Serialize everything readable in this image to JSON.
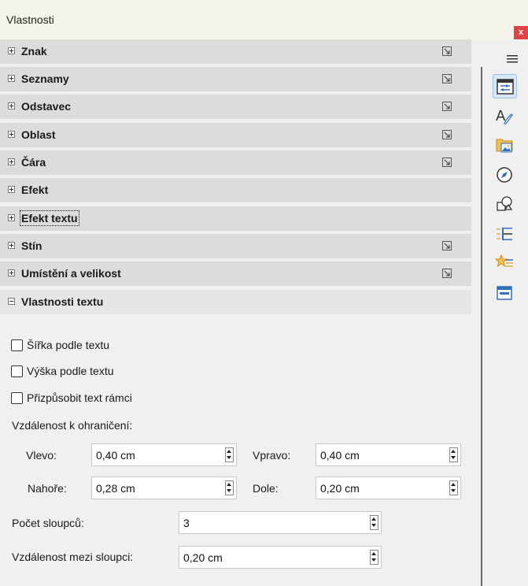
{
  "window": {
    "title": "Vlastnosti",
    "close_label": "x"
  },
  "sections": [
    {
      "label": "Znak",
      "expanded": false,
      "has_more": true
    },
    {
      "label": "Seznamy",
      "expanded": false,
      "has_more": true
    },
    {
      "label": "Odstavec",
      "expanded": false,
      "has_more": true
    },
    {
      "label": "Oblast",
      "expanded": false,
      "has_more": true
    },
    {
      "label": "Čára",
      "expanded": false,
      "has_more": true
    },
    {
      "label": "Efekt",
      "expanded": false,
      "has_more": false
    },
    {
      "label": "Efekt textu",
      "expanded": false,
      "has_more": false,
      "focused": true
    },
    {
      "label": "Stín",
      "expanded": false,
      "has_more": true
    },
    {
      "label": "Umístění a velikost",
      "expanded": false,
      "has_more": true
    },
    {
      "label": "Vlastnosti textu",
      "expanded": true,
      "has_more": false
    }
  ],
  "text_props": {
    "checkboxes": [
      {
        "label": "Šířka podle textu",
        "checked": false
      },
      {
        "label": "Výška podle textu",
        "checked": false
      },
      {
        "label": "Přizpůsobit text rámci",
        "checked": false
      }
    ],
    "border_distance_label": "Vzdálenost k ohraničení:",
    "left_label": "Vlevo:",
    "left_value": "0,40 cm",
    "right_label": "Vpravo:",
    "right_value": "0,40 cm",
    "top_label": "Nahoře:",
    "top_value": "0,28 cm",
    "bottom_label": "Dole:",
    "bottom_value": "0,20 cm",
    "columns_label": "Počet sloupců:",
    "columns_value": "3",
    "spacing_label": "Vzdálenost mezi sloupci:",
    "spacing_value": "0,20 cm"
  },
  "sidebar_tabs": [
    {
      "name": "properties-tab",
      "icon": "properties-icon",
      "active": true
    },
    {
      "name": "styles-tab",
      "icon": "styles-icon",
      "active": false
    },
    {
      "name": "gallery-tab",
      "icon": "gallery-icon",
      "active": false
    },
    {
      "name": "navigator-tab",
      "icon": "navigator-icon",
      "active": false
    },
    {
      "name": "shapes-tab",
      "icon": "shapes-icon",
      "active": false
    },
    {
      "name": "animation-tab",
      "icon": "animation-icon",
      "active": false
    },
    {
      "name": "slide-transition-tab",
      "icon": "slide-transition-icon",
      "active": false
    },
    {
      "name": "master-slides-tab",
      "icon": "master-slides-icon",
      "active": false
    }
  ],
  "colors": {
    "accent": "#2f6fc0",
    "close": "#e04343",
    "active_tab": "#d8e6f5"
  }
}
